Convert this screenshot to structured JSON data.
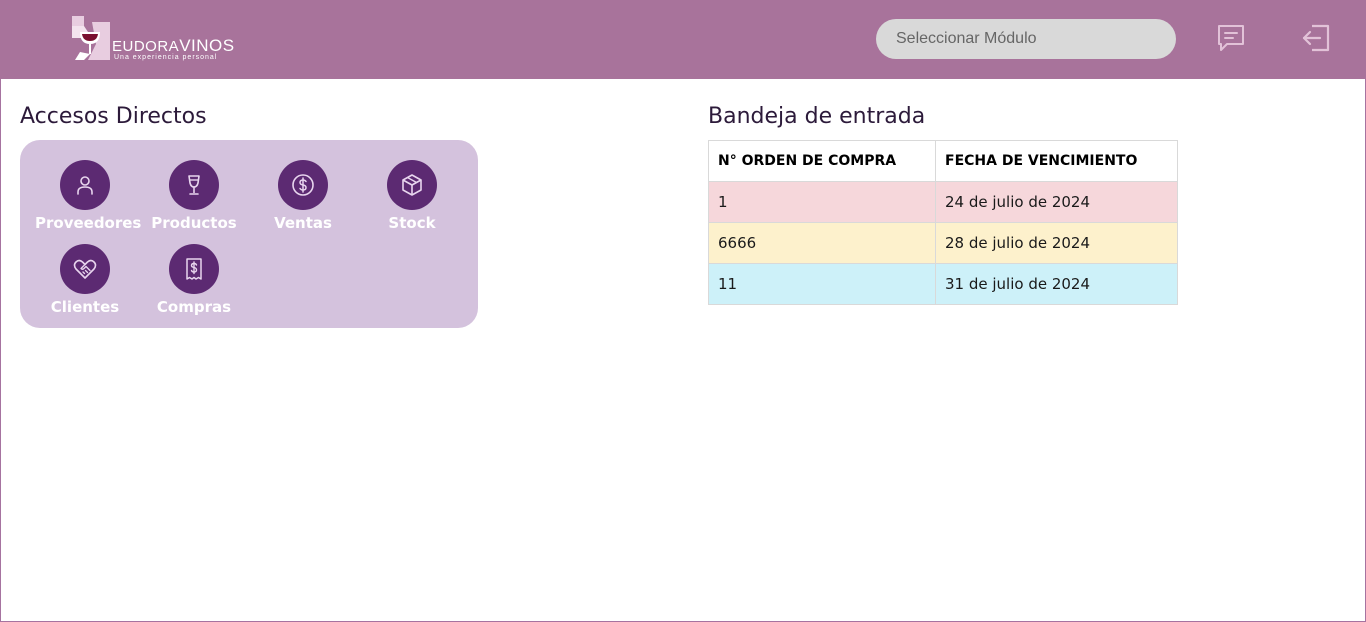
{
  "header": {
    "logo": {
      "brand_part1": "EUDORA",
      "brand_part2": "VINOS",
      "tagline": "Una experiencia personal"
    },
    "module_select": {
      "placeholder": "Seleccionar Módulo"
    },
    "icons": [
      "chat-icon",
      "logout-icon"
    ]
  },
  "shortcuts": {
    "title": "Accesos Directos",
    "items": [
      {
        "label": "Proveedores",
        "icon": "user-icon"
      },
      {
        "label": "Productos",
        "icon": "wine-glass-icon"
      },
      {
        "label": "Ventas",
        "icon": "dollar-coin-icon"
      },
      {
        "label": "Stock",
        "icon": "box-icon"
      },
      {
        "label": "Clientes",
        "icon": "handshake-heart-icon"
      },
      {
        "label": "Compras",
        "icon": "receipt-icon"
      }
    ]
  },
  "inbox": {
    "title": "Bandeja de entrada",
    "columns": [
      "N° ORDEN DE COMPRA",
      "FECHA DE VENCIMIENTO"
    ],
    "rows": [
      {
        "order": "1",
        "due": "24 de julio de 2024",
        "color": "#f6d7db"
      },
      {
        "order": "6666",
        "due": "28 de julio de 2024",
        "color": "#fdf1cc"
      },
      {
        "order": "11",
        "due": "31 de julio de 2024",
        "color": "#cdf1f9"
      }
    ]
  },
  "colors": {
    "header_bg": "#a8739b",
    "panel_bg": "#d4c2dd",
    "icon_circle": "#5c2a72"
  }
}
